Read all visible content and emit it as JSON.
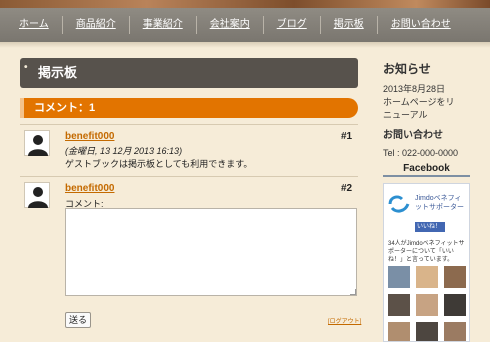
{
  "nav": {
    "items": [
      {
        "label": "ホーム"
      },
      {
        "label": "商品紹介"
      },
      {
        "label": "事業紹介"
      },
      {
        "label": "会社案内"
      },
      {
        "label": "ブログ"
      },
      {
        "label": "掲示板"
      },
      {
        "label": "お問い合わせ"
      }
    ]
  },
  "main": {
    "page_title": "掲示板",
    "comment_count_label": "コメント：1",
    "comments": [
      {
        "author": "benefit000",
        "number": "#1",
        "date": "(金曜日, 13 12月 2013 16:13)",
        "text": "ゲストブックは掲示板としても利用できます。"
      }
    ],
    "form": {
      "author": "benefit000",
      "number": "#2",
      "comment_label": "コメント:",
      "textarea_value": "",
      "send_label": "送る",
      "logout_label": "[ログアウト]"
    }
  },
  "sidebar": {
    "news_title": "お知らせ",
    "news_date": "2013年8月28日",
    "news_line1": "ホームページをリ",
    "news_line2": "ニューアル",
    "contact_title": "お問い合わせ",
    "contact_tel": "Tel : 022-000-0000",
    "facebook_title": "Facebook",
    "fb_page_name": "Jimdoベネフィットサポーター",
    "fb_like_label": "いいね！",
    "fb_count_text": "34人がJimdoベネフィットサポーターについて「いいね！」と言っています。"
  },
  "colors": {
    "accent": "#e27400",
    "title_bar": "#57524c",
    "nav_bg": "#8a867e",
    "page_bg": "#f6ecd8",
    "link": "#c46a00",
    "facebook": "#3b5998"
  }
}
